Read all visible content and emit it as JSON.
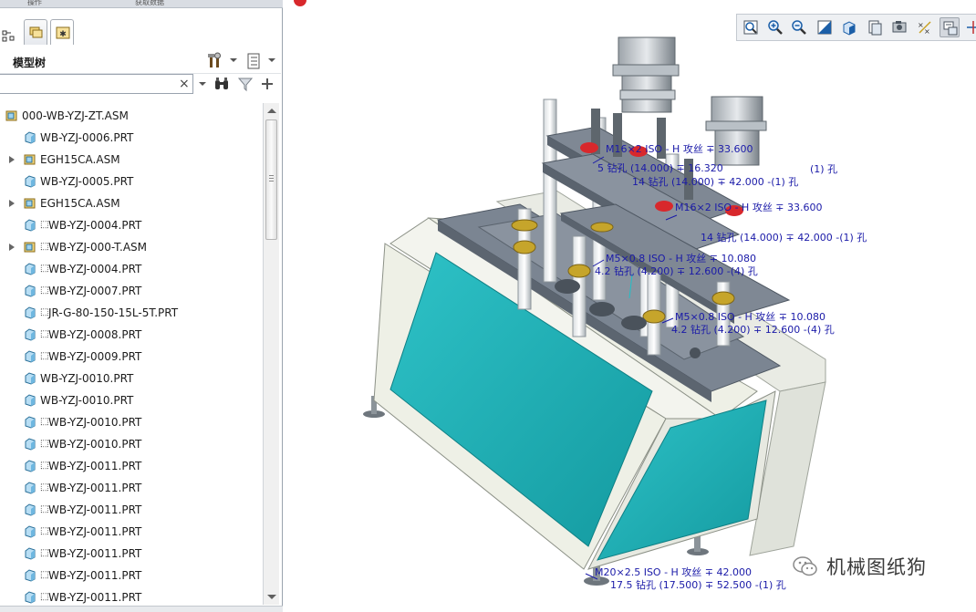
{
  "top_tabs": [
    "操作",
    "获取数据"
  ],
  "model_tree": {
    "title": "模型树",
    "search": {
      "value": "",
      "placeholder": ""
    },
    "items": [
      {
        "label": "000-WB-YZJ-ZT.ASM",
        "type": "asm",
        "indent": 0,
        "expandable": false,
        "ref": false
      },
      {
        "label": "WB-YZJ-0006.PRT",
        "type": "prt",
        "indent": 1,
        "expandable": false,
        "ref": false
      },
      {
        "label": "EGH15CA.ASM",
        "type": "asm",
        "indent": 1,
        "expandable": true,
        "ref": false
      },
      {
        "label": "WB-YZJ-0005.PRT",
        "type": "prt",
        "indent": 1,
        "expandable": false,
        "ref": false
      },
      {
        "label": "EGH15CA.ASM",
        "type": "asm",
        "indent": 1,
        "expandable": true,
        "ref": false
      },
      {
        "label": "WB-YZJ-0004.PRT",
        "type": "prt",
        "indent": 1,
        "expandable": false,
        "ref": true
      },
      {
        "label": "WB-YZJ-000-T.ASM",
        "type": "asm",
        "indent": 1,
        "expandable": true,
        "ref": true
      },
      {
        "label": "WB-YZJ-0004.PRT",
        "type": "prt",
        "indent": 1,
        "expandable": false,
        "ref": true
      },
      {
        "label": "WB-YZJ-0007.PRT",
        "type": "prt",
        "indent": 1,
        "expandable": false,
        "ref": true
      },
      {
        "label": "JR-G-80-150-15L-5T.PRT",
        "type": "prt",
        "indent": 1,
        "expandable": false,
        "ref": true
      },
      {
        "label": "WB-YZJ-0008.PRT",
        "type": "prt",
        "indent": 1,
        "expandable": false,
        "ref": true
      },
      {
        "label": "WB-YZJ-0009.PRT",
        "type": "prt",
        "indent": 1,
        "expandable": false,
        "ref": true
      },
      {
        "label": "WB-YZJ-0010.PRT",
        "type": "prt",
        "indent": 1,
        "expandable": false,
        "ref": false
      },
      {
        "label": "WB-YZJ-0010.PRT",
        "type": "prt",
        "indent": 1,
        "expandable": false,
        "ref": false
      },
      {
        "label": "WB-YZJ-0010.PRT",
        "type": "prt",
        "indent": 1,
        "expandable": false,
        "ref": true
      },
      {
        "label": "WB-YZJ-0010.PRT",
        "type": "prt",
        "indent": 1,
        "expandable": false,
        "ref": true
      },
      {
        "label": "WB-YZJ-0011.PRT",
        "type": "prt",
        "indent": 1,
        "expandable": false,
        "ref": true
      },
      {
        "label": "WB-YZJ-0011.PRT",
        "type": "prt",
        "indent": 1,
        "expandable": false,
        "ref": true
      },
      {
        "label": "WB-YZJ-0011.PRT",
        "type": "prt",
        "indent": 1,
        "expandable": false,
        "ref": true
      },
      {
        "label": "WB-YZJ-0011.PRT",
        "type": "prt",
        "indent": 1,
        "expandable": false,
        "ref": true
      },
      {
        "label": "WB-YZJ-0011.PRT",
        "type": "prt",
        "indent": 1,
        "expandable": false,
        "ref": true
      },
      {
        "label": "WB-YZJ-0011.PRT",
        "type": "prt",
        "indent": 1,
        "expandable": false,
        "ref": true
      },
      {
        "label": "WB-YZJ-0011.PRT",
        "type": "prt",
        "indent": 1,
        "expandable": false,
        "ref": true
      }
    ]
  },
  "view_toolbar": {
    "buttons": [
      "refit-icon",
      "zoom-in-icon",
      "zoom-out-icon",
      "repaint-icon",
      "shading-icon",
      "saved-views-icon",
      "display-style-icon",
      "datum-display-icon",
      "annotation-display-icon",
      "spin-center-icon"
    ],
    "pressed_index": 8
  },
  "annotations": {
    "top1": "M16×2 ISO - H 攻丝 ∓ 33.600",
    "top2": "5 钻孔 (14.000) ∓ 16.320",
    "top3": "(1) 孔",
    "top4": "14 钻孔 (14.000) ∓ 42.000 -(1) 孔",
    "mid1": "M16×2 ISO - H 攻丝 ∓ 33.600",
    "mid2": "14 钻孔 (14.000) ∓ 42.000 -(1) 孔",
    "mid3": "M5×0.8 ISO - H 攻丝 ∓ 10.080",
    "mid4": "4.2 钻孔 (4.200) ∓ 12.600 -(4) 孔",
    "low1": "M5×0.8 ISO - H 攻丝 ∓ 10.080",
    "low2": "4.2 钻孔 (4.200) ∓ 12.600 -(4) 孔",
    "bot1": "M20×2.5 ISO - H 攻丝 ∓ 42.000",
    "bot2": "17.5 钻孔 (17.500) ∓ 52.500 -(1) 孔"
  },
  "watermark": {
    "text": "机械图纸狗"
  },
  "colors": {
    "cabinet_teal": "#1fb0b5",
    "frame_white": "#eef0e6",
    "plate_gray": "#7b8592",
    "annotation_blue": "#1a1aa8",
    "accent_red": "#d8282c",
    "brass": "#c6a52b"
  }
}
